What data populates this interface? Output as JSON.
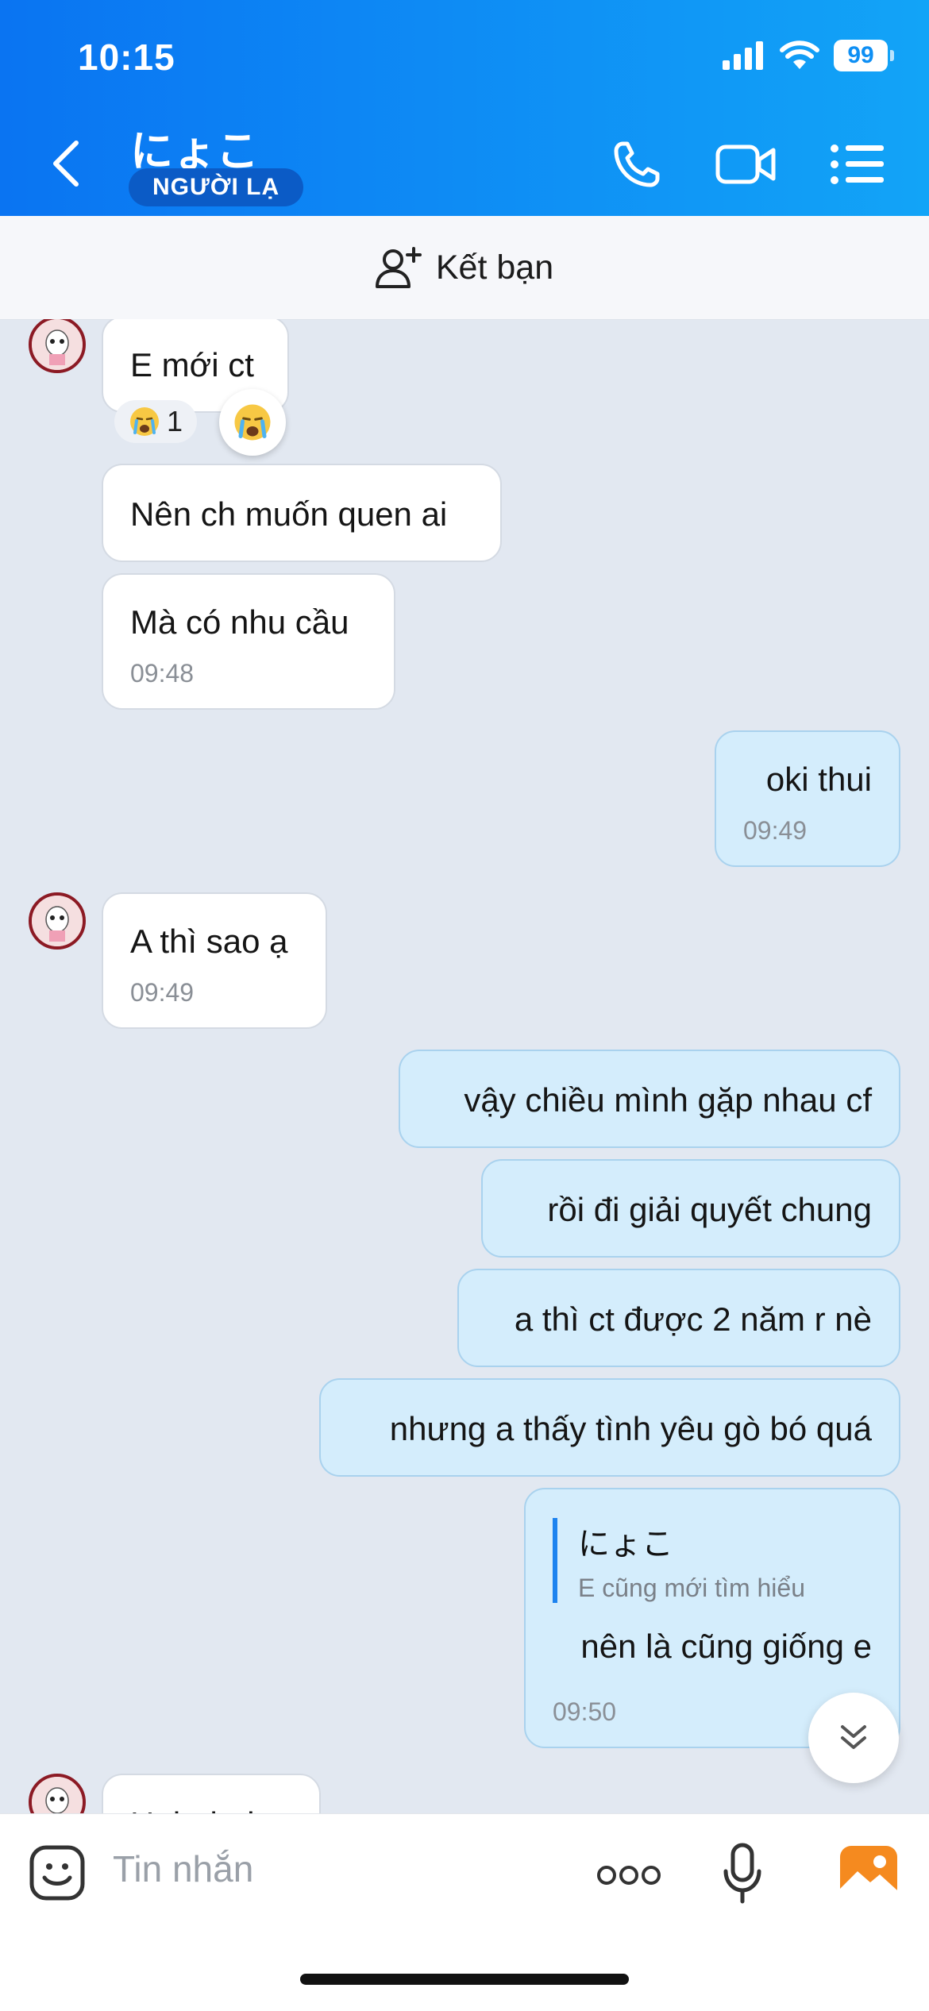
{
  "status_bar": {
    "time": "10:15",
    "battery": "99"
  },
  "header": {
    "contact_name": "にょこ",
    "badge": "NGƯỜI LẠ",
    "icons": [
      "back-chevron-icon",
      "phone-icon",
      "video-call-icon",
      "menu-list-icon"
    ]
  },
  "friend_bar": {
    "label": "Kết bạn",
    "icon": "add-friend-icon"
  },
  "messages": [
    {
      "side": "in",
      "text": "E mới ct",
      "reaction_count": "1",
      "reaction": "crying-emoji"
    },
    {
      "side": "in",
      "text": "Nên ch muốn quen ai"
    },
    {
      "side": "in",
      "text": "Mà có nhu cầu",
      "time": "09:48"
    },
    {
      "side": "out",
      "text": "oki thui",
      "time": "09:49"
    },
    {
      "side": "in",
      "text": "A thì sao ạ",
      "time": "09:49"
    },
    {
      "side": "out",
      "text": "vậy chiều mình gặp nhau cf"
    },
    {
      "side": "out",
      "text": "rồi đi giải quyết chung"
    },
    {
      "side": "out",
      "text": "a thì ct được 2 năm r nè"
    },
    {
      "side": "out",
      "text": "nhưng a thấy tình yêu gò bó quá"
    },
    {
      "side": "out",
      "quote_name": "にょこ",
      "quote_text": "E cũng mới tìm hiểu",
      "text": "nên là cũng giống e",
      "time": "09:50"
    },
    {
      "side": "in",
      "text": "Hahahaha"
    }
  ],
  "input": {
    "placeholder": "Tin nhắn",
    "icons": [
      "sticker-icon",
      "more-icon",
      "microphone-icon",
      "image-gallery-icon"
    ]
  },
  "colors": {
    "header_start": "#0a74f2",
    "header_end": "#12a4f7",
    "bubble_out": "#d4edfc",
    "bubble_in": "#ffffff",
    "chat_bg": "#e2e8f1"
  }
}
